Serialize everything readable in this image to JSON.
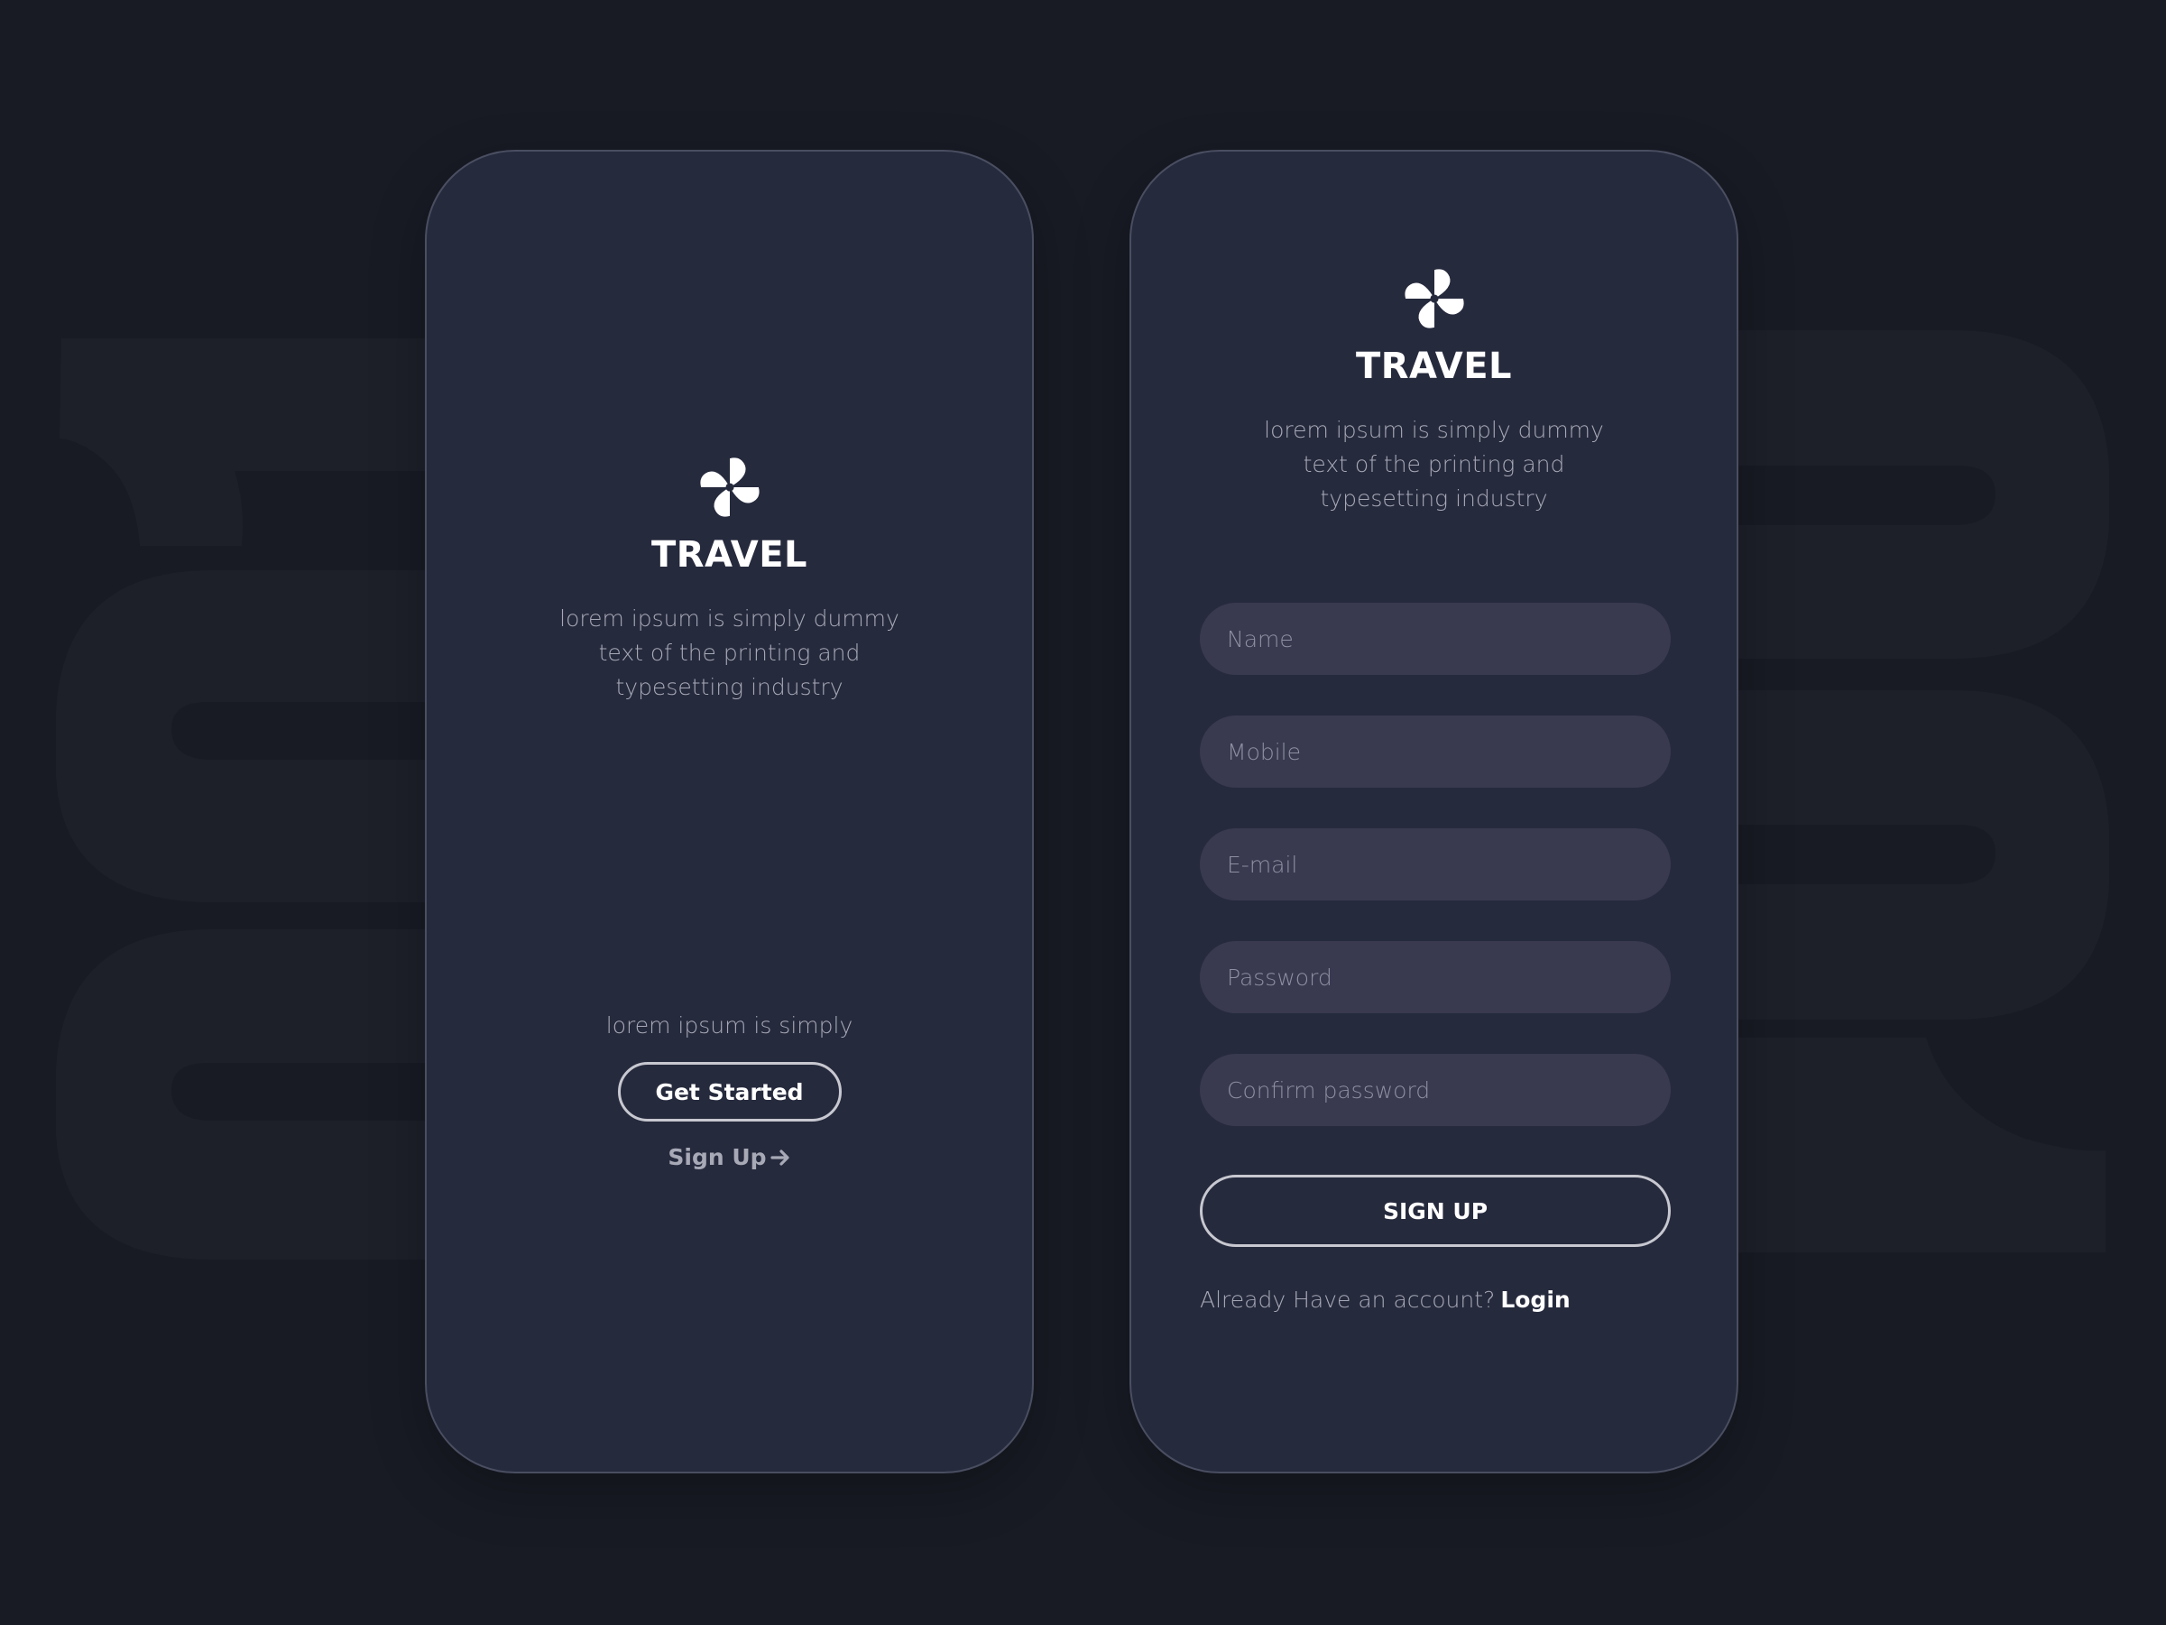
{
  "colors": {
    "background": "#181b24",
    "card": "#262a3d",
    "input": "#393a50",
    "text_primary": "#ffffff",
    "text_muted": "#a7a9b6"
  },
  "welcome_screen": {
    "logo_icon": "pinwheel-icon",
    "brand": "TRAVEL",
    "tagline": "lorem ipsum is simply dummy text of the printing and typesetting industry",
    "small_text": "lorem ipsum is simply",
    "get_started_label": "Get Started",
    "signup_link_label": "Sign Up",
    "signup_link_icon": "arrow-right-icon"
  },
  "signup_screen": {
    "logo_icon": "pinwheel-icon",
    "brand": "TRAVEL",
    "tagline": "lorem ipsum is simply dummy text of the printing and typesetting industry",
    "fields": {
      "name_placeholder": "Name",
      "mobile_placeholder": "Mobile",
      "email_placeholder": "E-mail",
      "password_placeholder": "Password",
      "confirm_password_placeholder": "Confirm password"
    },
    "signup_button_label": "SIGN UP",
    "account_prompt": "Already Have an account?",
    "login_label": "Login"
  }
}
